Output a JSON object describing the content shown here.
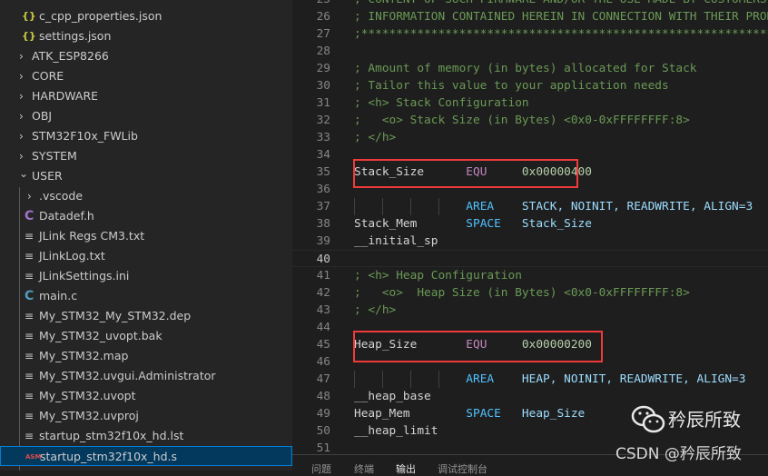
{
  "explorer": {
    "items": [
      {
        "label": "c_cpp_properties.json",
        "icon": "json-icon",
        "kind": "file",
        "depth": 1
      },
      {
        "label": "settings.json",
        "icon": "json-icon",
        "kind": "file",
        "depth": 1
      },
      {
        "label": "ATK_ESP8266",
        "icon": "chevron-right-icon",
        "kind": "folder",
        "depth": 0
      },
      {
        "label": "CORE",
        "icon": "chevron-right-icon",
        "kind": "folder",
        "depth": 0
      },
      {
        "label": "HARDWARE",
        "icon": "chevron-right-icon",
        "kind": "folder",
        "depth": 0
      },
      {
        "label": "OBJ",
        "icon": "chevron-right-icon",
        "kind": "folder",
        "depth": 0
      },
      {
        "label": "STM32F10x_FWLib",
        "icon": "chevron-right-icon",
        "kind": "folder",
        "depth": 0
      },
      {
        "label": "SYSTEM",
        "icon": "chevron-right-icon",
        "kind": "folder",
        "depth": 0
      },
      {
        "label": "USER",
        "icon": "chevron-down-icon",
        "kind": "folder",
        "depth": 0
      },
      {
        "label": ".vscode",
        "icon": "chevron-right-icon",
        "kind": "folder",
        "depth": 1
      },
      {
        "label": "Datadef.h",
        "icon": "c-header-icon",
        "kind": "file",
        "depth": 1
      },
      {
        "label": "JLink Regs CM3.txt",
        "icon": "text-file-icon",
        "kind": "file",
        "depth": 1
      },
      {
        "label": "JLinkLog.txt",
        "icon": "text-file-icon",
        "kind": "file",
        "depth": 1
      },
      {
        "label": "JLinkSettings.ini",
        "icon": "text-file-icon",
        "kind": "file",
        "depth": 1
      },
      {
        "label": "main.c",
        "icon": "c-file-icon",
        "kind": "file",
        "depth": 1
      },
      {
        "label": "My_STM32_My_STM32.dep",
        "icon": "text-file-icon",
        "kind": "file",
        "depth": 1
      },
      {
        "label": "My_STM32_uvopt.bak",
        "icon": "text-file-icon",
        "kind": "file",
        "depth": 1
      },
      {
        "label": "My_STM32.map",
        "icon": "text-file-icon",
        "kind": "file",
        "depth": 1
      },
      {
        "label": "My_STM32.uvgui.Administrator",
        "icon": "text-file-icon",
        "kind": "file",
        "depth": 1
      },
      {
        "label": "My_STM32.uvopt",
        "icon": "text-file-icon",
        "kind": "file",
        "depth": 1
      },
      {
        "label": "My_STM32.uvproj",
        "icon": "text-file-icon",
        "kind": "file",
        "depth": 1
      },
      {
        "label": "startup_stm32f10x_hd.lst",
        "icon": "text-file-icon",
        "kind": "file",
        "depth": 1
      },
      {
        "label": "startup_stm32f10x_hd.s",
        "icon": "asm-file-icon",
        "kind": "file",
        "depth": 1,
        "selected": true
      }
    ],
    "icon_glyphs": {
      "json-icon": "{}",
      "chevron-right-icon": "›",
      "chevron-down-icon": "⌄",
      "c-header-icon": "C",
      "c-file-icon": "C",
      "text-file-icon": "≡",
      "asm-file-icon": "ASM"
    }
  },
  "editor": {
    "current_line": 40,
    "highlighted_lines": [
      35,
      45
    ],
    "indent_guide_lines": [
      37,
      47
    ],
    "lines": [
      {
        "n": 25,
        "tokens": [
          {
            "t": "; CONTENT OF SUCH FIRMWARE AND/OR THE USE MADE BY CUSTOMERS OF THE CODING",
            "k": "comment"
          }
        ]
      },
      {
        "n": 26,
        "tokens": [
          {
            "t": "; INFORMATION CONTAINED HEREIN IN CONNECTION WITH THEIR PRODUCTS.",
            "k": "comment"
          }
        ]
      },
      {
        "n": 27,
        "tokens": [
          {
            "t": ";*******************************************************************************",
            "k": "comment"
          }
        ]
      },
      {
        "n": 28,
        "tokens": []
      },
      {
        "n": 29,
        "tokens": [
          {
            "t": "; Amount of memory (in bytes) allocated for Stack",
            "k": "comment"
          }
        ]
      },
      {
        "n": 30,
        "tokens": [
          {
            "t": "; Tailor this value to your application needs",
            "k": "comment"
          }
        ]
      },
      {
        "n": 31,
        "tokens": [
          {
            "t": "; <h> Stack Configuration",
            "k": "comment"
          }
        ]
      },
      {
        "n": 32,
        "tokens": [
          {
            "t": ";   <o> Stack Size (in Bytes) <0x0-0xFFFFFFFF:8>",
            "k": "comment"
          }
        ]
      },
      {
        "n": 33,
        "tokens": [
          {
            "t": "; </h>",
            "k": "comment"
          }
        ]
      },
      {
        "n": 34,
        "tokens": []
      },
      {
        "n": 35,
        "tokens": [
          {
            "t": "Stack_Size      ",
            "k": "label"
          },
          {
            "t": "EQU     ",
            "k": "keyword"
          },
          {
            "t": "0x00000400",
            "k": "number"
          }
        ]
      },
      {
        "n": 36,
        "tokens": []
      },
      {
        "n": 37,
        "tokens": [
          {
            "t": "                ",
            "k": "label"
          },
          {
            "t": "AREA    ",
            "k": "directive"
          },
          {
            "t": "STACK, NOINIT, READWRITE, ALIGN=3",
            "k": "operand"
          }
        ]
      },
      {
        "n": 38,
        "tokens": [
          {
            "t": "Stack_Mem       ",
            "k": "label"
          },
          {
            "t": "SPACE   ",
            "k": "directive"
          },
          {
            "t": "Stack_Size",
            "k": "operand"
          }
        ]
      },
      {
        "n": 39,
        "tokens": [
          {
            "t": "__initial_sp",
            "k": "label"
          }
        ]
      },
      {
        "n": 40,
        "tokens": []
      },
      {
        "n": 41,
        "tokens": [
          {
            "t": "; <h> Heap Configuration",
            "k": "comment"
          }
        ]
      },
      {
        "n": 42,
        "tokens": [
          {
            "t": ";   <o>  Heap Size (in Bytes) <0x0-0xFFFFFFFF:8>",
            "k": "comment"
          }
        ]
      },
      {
        "n": 43,
        "tokens": [
          {
            "t": "; </h>",
            "k": "comment"
          }
        ]
      },
      {
        "n": 44,
        "tokens": []
      },
      {
        "n": 45,
        "tokens": [
          {
            "t": "Heap_Size       ",
            "k": "label"
          },
          {
            "t": "EQU     ",
            "k": "keyword"
          },
          {
            "t": "0x00000200",
            "k": "number"
          }
        ]
      },
      {
        "n": 46,
        "tokens": []
      },
      {
        "n": 47,
        "tokens": [
          {
            "t": "                ",
            "k": "label"
          },
          {
            "t": "AREA    ",
            "k": "directive"
          },
          {
            "t": "HEAP, NOINIT, READWRITE, ALIGN=3",
            "k": "operand"
          }
        ]
      },
      {
        "n": 48,
        "tokens": [
          {
            "t": "__heap_base",
            "k": "label"
          }
        ]
      },
      {
        "n": 49,
        "tokens": [
          {
            "t": "Heap_Mem        ",
            "k": "label"
          },
          {
            "t": "SPACE   ",
            "k": "directive"
          },
          {
            "t": "Heap_Size",
            "k": "operand"
          }
        ]
      },
      {
        "n": 50,
        "tokens": [
          {
            "t": "__heap_limit",
            "k": "label"
          }
        ]
      },
      {
        "n": 51,
        "tokens": []
      }
    ]
  },
  "panel": {
    "tabs": [
      {
        "label": "问题"
      },
      {
        "label": "终端"
      },
      {
        "label": "输出",
        "active": true
      },
      {
        "label": "调试控制台"
      }
    ]
  },
  "watermark": {
    "name": "矜辰所致",
    "csdn": "CSDN @矜辰所致"
  },
  "colors": {
    "highlight_box": "#f03b3b",
    "selection": "#04395e",
    "comment": "#6a9955",
    "keyword": "#c586c0",
    "number": "#b5cea8"
  }
}
